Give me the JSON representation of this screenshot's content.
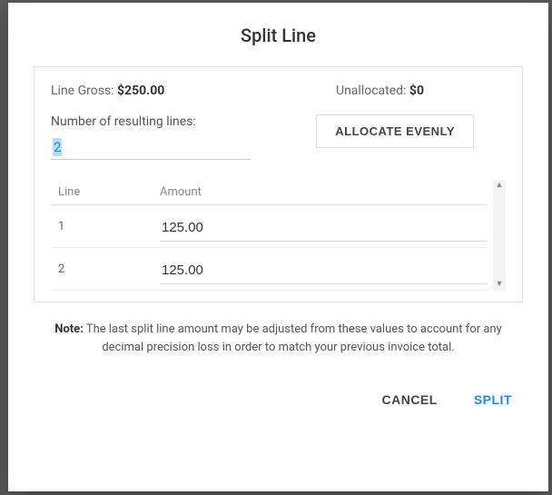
{
  "title": "Split Line",
  "lineGross": {
    "label": "Line Gross: ",
    "value": "$250.00"
  },
  "unallocated": {
    "label": "Unallocated: ",
    "value": "$0"
  },
  "numLines": {
    "label": "Number of resulting lines:",
    "value": "2"
  },
  "allocateButton": "ALLOCATE EVENLY",
  "table": {
    "headers": {
      "line": "Line",
      "amount": "Amount"
    },
    "rows": [
      {
        "line": "1",
        "amount": "125.00"
      },
      {
        "line": "2",
        "amount": "125.00"
      }
    ]
  },
  "note": {
    "label": "Note:",
    "text": " The last split line amount may be adjusted from these values to account for any decimal precision loss in order to match your previous invoice total."
  },
  "actions": {
    "cancel": "CANCEL",
    "split": "SPLIT"
  }
}
